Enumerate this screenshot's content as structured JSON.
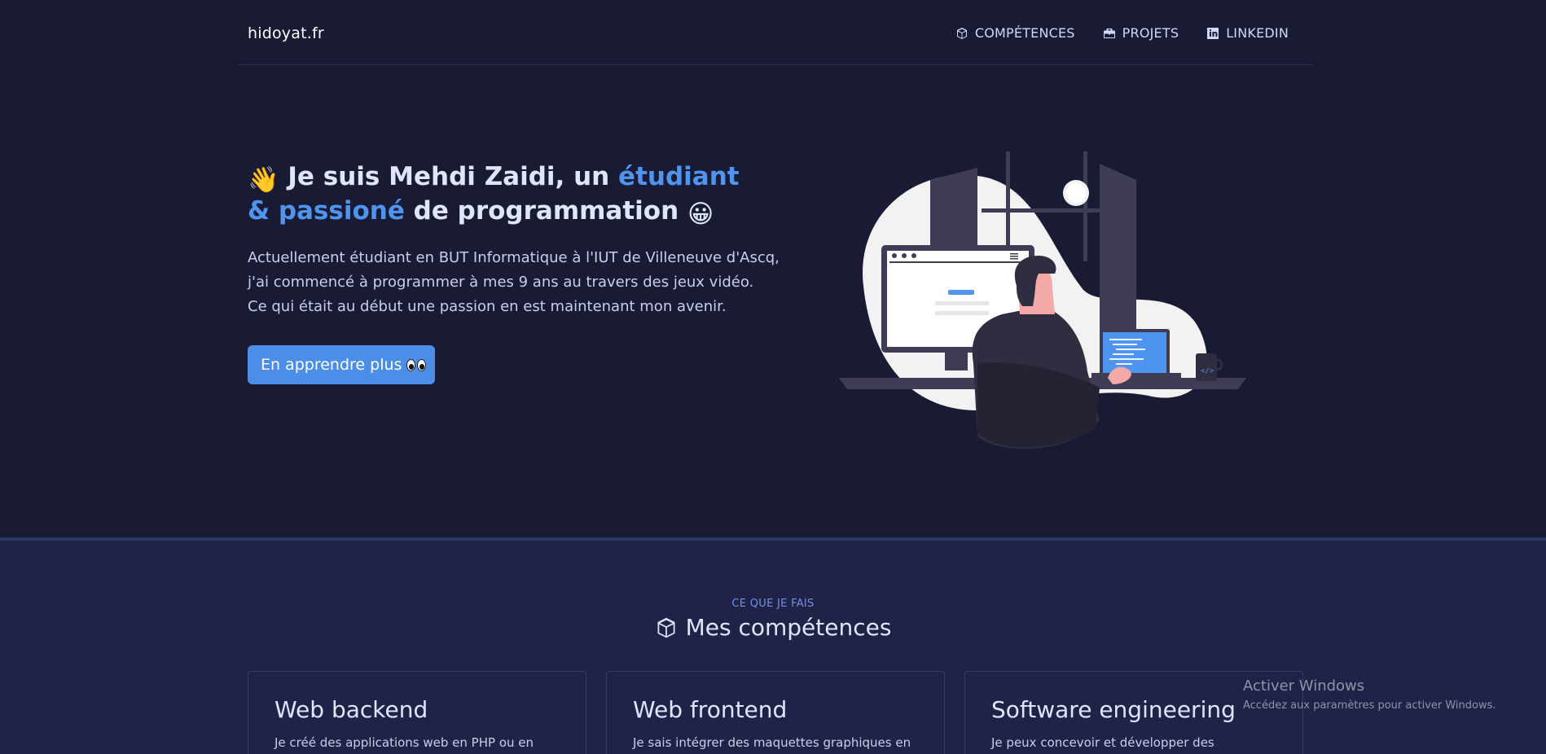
{
  "nav": {
    "brand": "hidoyat.fr",
    "links": [
      {
        "label": "COMPÉTENCES",
        "icon": "cube-icon"
      },
      {
        "label": "PROJETS",
        "icon": "briefcase-icon"
      },
      {
        "label": "LINKEDIN",
        "icon": "linkedin-icon"
      }
    ]
  },
  "hero": {
    "wave_emoji": "👋",
    "title_part1": " Je suis Mehdi Zaidi, un ",
    "title_accent": "étudiant & passioné",
    "title_part2": " de programmation ",
    "smile_emoji": "😀",
    "text_lines": [
      "Actuellement étudiant en BUT Informatique à l'IUT de Villeneuve d'Ascq,",
      "j'ai commencé à programmer à mes 9 ans au travers des jeux vidéo.",
      "Ce qui était au début une passion en est maintenant mon avenir."
    ],
    "cta_label": "En apprendre plus"
  },
  "skills": {
    "eyebrow": "CE QUE JE FAIS",
    "title": "Mes compétences",
    "cards": [
      {
        "title": "Web backend",
        "text": "Je créé des applications web en PHP ou en Java"
      },
      {
        "title": "Web frontend",
        "text": "Je sais intégrer des maquettes graphiques en"
      },
      {
        "title": "Software engineering",
        "text": "Je peux concevoir et développer des applications"
      }
    ]
  },
  "windows_activation": {
    "title": "Activer Windows",
    "subtitle": "Accédez aux paramètres pour activer Windows."
  },
  "colors": {
    "background": "#191b35",
    "section_background": "#202347",
    "accent": "#4f95ef",
    "button": "#4b8ee8"
  }
}
